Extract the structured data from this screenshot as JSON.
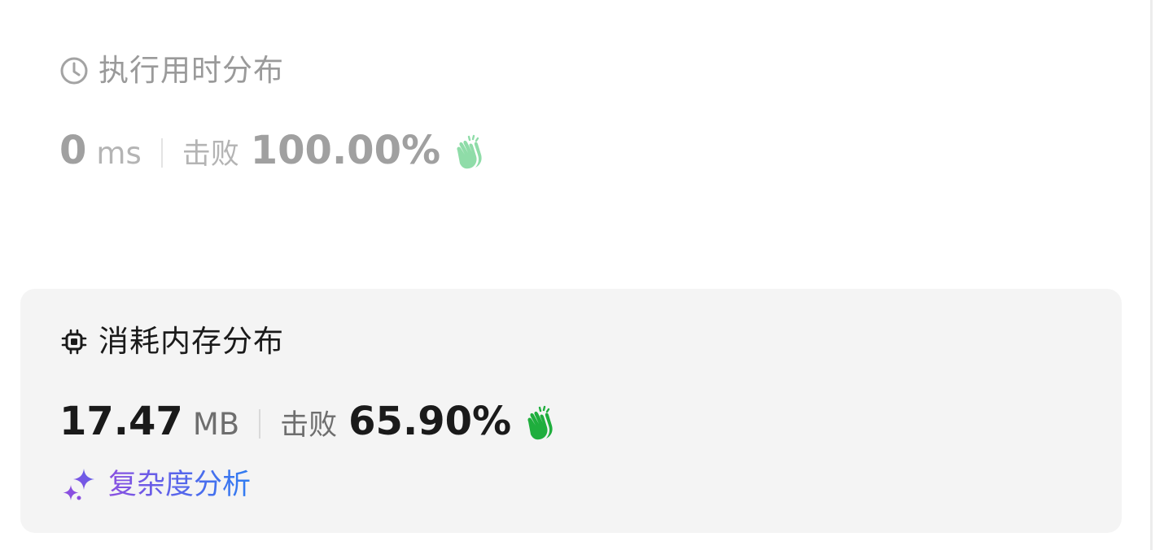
{
  "runtime": {
    "title": "执行用时分布",
    "value": "0",
    "unit": "ms",
    "beats_label": "击败",
    "beats_value": "100.00%",
    "header_icon": "clock-icon",
    "clap_icon": "clap-icon",
    "clap_color": "#8fdca8",
    "active": false
  },
  "memory": {
    "title": "消耗内存分布",
    "value": "17.47",
    "unit": "MB",
    "beats_label": "击败",
    "beats_value": "65.90%",
    "header_icon": "cpu-chip-icon",
    "clap_icon": "clap-icon",
    "clap_color": "#1fae3d",
    "active": true
  },
  "complexity_link": {
    "label": "复杂度分析",
    "icon": "sparkle-icon",
    "gradient": [
      "#8a4fe0",
      "#2f7df2"
    ]
  }
}
